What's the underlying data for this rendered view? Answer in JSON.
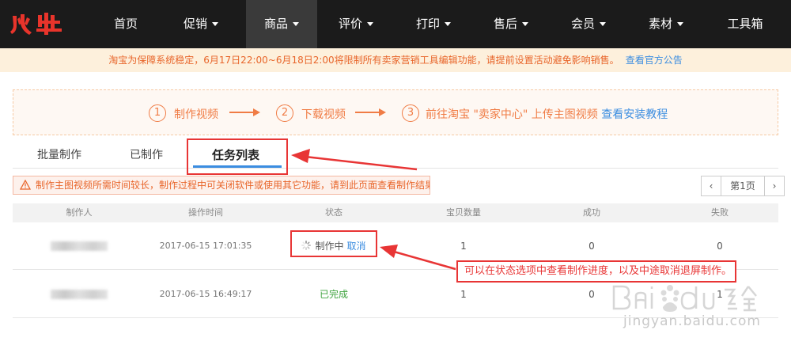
{
  "nav": {
    "brand": "火牛",
    "items": [
      {
        "label": "首页",
        "caret": false
      },
      {
        "label": "促销",
        "caret": true
      },
      {
        "label": "商品",
        "caret": true,
        "active": true
      },
      {
        "label": "评价",
        "caret": true
      },
      {
        "label": "打印",
        "caret": true
      },
      {
        "label": "售后",
        "caret": true
      },
      {
        "label": "会员",
        "caret": true
      },
      {
        "label": "素材",
        "caret": true
      },
      {
        "label": "工具箱",
        "caret": false
      }
    ]
  },
  "notice": {
    "text": "淘宝为保障系统稳定，6月17日22:00~6月18日2:00将限制所有卖家营销工具编辑功能，请提前设置活动避免影响销售。",
    "link": "查看官方公告"
  },
  "steps": [
    {
      "num": "1",
      "text": "制作视频"
    },
    {
      "num": "2",
      "text": "下载视频"
    },
    {
      "num": "3",
      "text": "前往淘宝 \"卖家中心\" 上传主图视频",
      "link": "查看安装教程"
    }
  ],
  "tabs": [
    "批量制作",
    "已制作",
    "任务列表"
  ],
  "warning": "制作主图视频所需时间较长，制作过程中可关闭软件或使用其它功能，请到此页面查看制作结果！",
  "pager": {
    "prev": "‹",
    "label": "第1页",
    "next": "›"
  },
  "table": {
    "headers": [
      "制作人",
      "操作时间",
      "状态",
      "宝贝数量",
      "成功",
      "失败"
    ],
    "rows": [
      {
        "time": "2017-06-15 17:01:35",
        "status": "制作中",
        "action": "取消",
        "count": "1",
        "success": "0",
        "fail": "0"
      },
      {
        "time": "2017-06-15 16:49:17",
        "status": "已完成",
        "count": "1",
        "success": "0",
        "fail": "1"
      }
    ]
  },
  "annotation": "可以在状态选项中查看制作进度，以及中途取消退屏制作。",
  "watermark": {
    "text": "jingyan.baidu.com",
    "logo": "Bai du 经验"
  },
  "colors": {
    "accent": "#f07c45",
    "link": "#3b8de0",
    "annotation": "#e83535",
    "nav_bg": "#1b1b1b"
  }
}
